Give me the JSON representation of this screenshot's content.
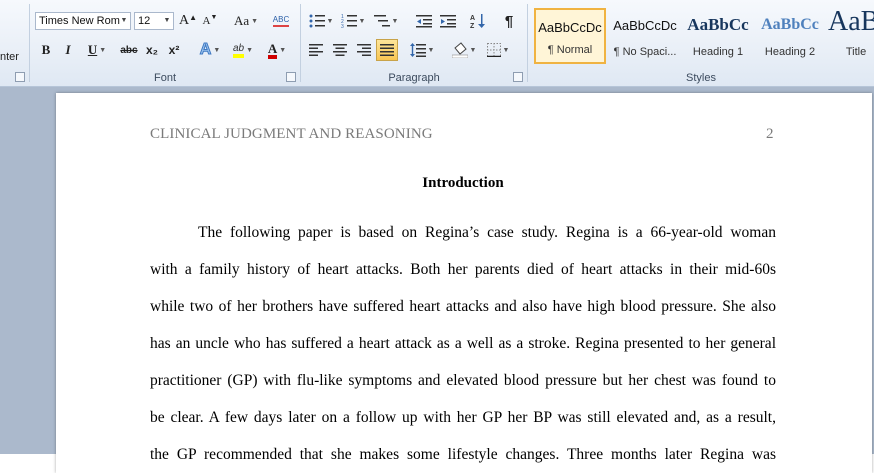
{
  "ribbon": {
    "clipboard": {
      "partial_label": "nter"
    },
    "font": {
      "label": "Font",
      "font_name": "Times New Rom",
      "font_size": "12",
      "grow": "A",
      "shrink": "A",
      "change_case": "Aa",
      "clear_formatting": "ABC",
      "bold": "B",
      "italic": "I",
      "underline": "U",
      "strikethrough": "abc",
      "subscript": "x₂",
      "superscript": "x²",
      "text_effects": "A",
      "highlight": "ab",
      "font_color": "A"
    },
    "paragraph": {
      "label": "Paragraph",
      "pilcrow": "¶"
    },
    "styles": {
      "label": "Styles",
      "items": [
        {
          "preview": "AaBbCcDc",
          "name": "¶ Normal"
        },
        {
          "preview": "AaBbCcDc",
          "name": "¶ No Spaci..."
        },
        {
          "preview": "AaBbCc",
          "name": "Heading 1"
        },
        {
          "preview": "AaBbCc",
          "name": "Heading 2"
        },
        {
          "preview": "AaB",
          "name": "Title"
        }
      ]
    }
  },
  "colors": {
    "highlight_bar": "#ffff00",
    "font_color_bar": "#d00000",
    "heading_blue": "#17365d",
    "heading2_blue": "#4f81bd"
  },
  "document": {
    "header_left": "CLINICAL JUDGMENT AND REASONING",
    "page_number": "2",
    "title": "Introduction",
    "lines": [
      "The following paper is based on Regina’s case study. Regina is a 66-year-old woman",
      "with a family history of heart attacks. Both her parents died of heart attacks in their mid-60s",
      "while two of her brothers have suffered heart attacks and also have high blood pressure. She also",
      "has an uncle who has suffered a heart attack as a well as a stroke. Regina presented to her general",
      "practitioner (GP) with flu-like symptoms and elevated blood pressure but her chest was found to",
      "be clear. A few days later on a follow up with her GP her BP was still elevated and, as a result,",
      "the GP recommended that she makes some lifestyle changes. Three months later Regina was"
    ]
  }
}
